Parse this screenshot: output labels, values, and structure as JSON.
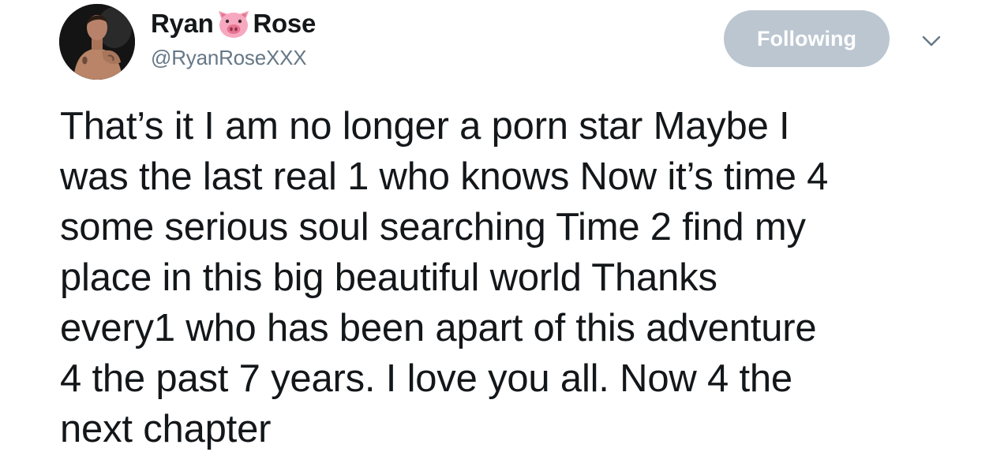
{
  "tweet": {
    "author": {
      "name_first": "Ryan",
      "name_last": "Rose",
      "name_emoji": "pig-face-emoji",
      "handle": "@RyanRoseXXX"
    },
    "follow_button_label": "Following",
    "menu_icon": "chevron-down-icon",
    "text_lines": [
      "That’s it I am no longer a porn star Maybe I",
      "was the last real 1 who knows Now it’s time 4",
      "some serious soul searching Time 2 find my",
      "place in this big beautiful world Thanks",
      "every1 who has been apart of this adventure",
      "4 the past 7 years. I love you all. Now 4 the",
      "next chapter"
    ]
  },
  "colors": {
    "text": "#14171a",
    "secondary_text": "#657786",
    "following_button_bg": "#bbc6d0",
    "following_button_text": "#ffffff",
    "chevron": "#657786"
  }
}
